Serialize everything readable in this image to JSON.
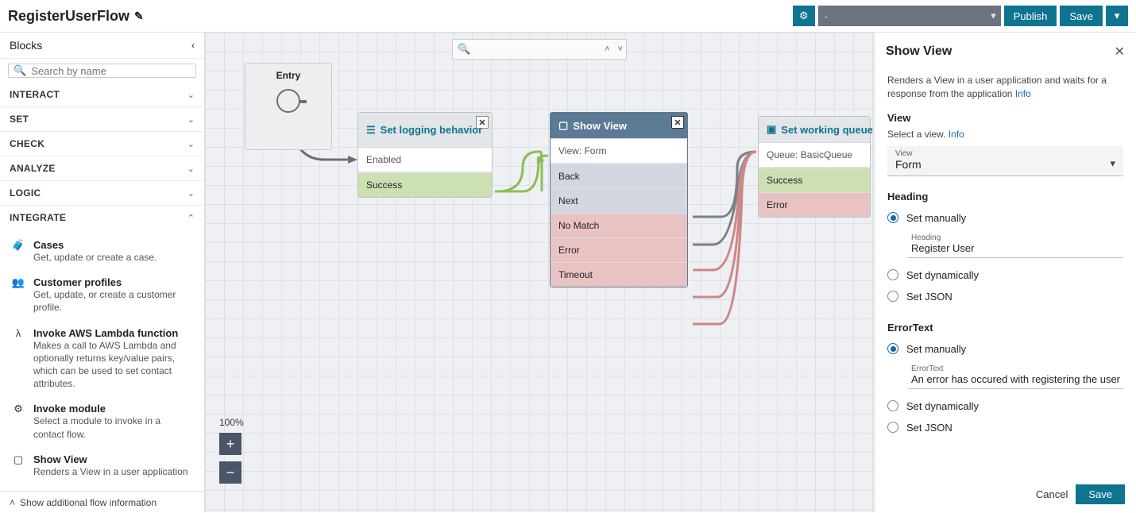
{
  "header": {
    "title": "RegisterUserFlow",
    "env_select": "-",
    "publish": "Publish",
    "save": "Save"
  },
  "sidebar": {
    "title": "Blocks",
    "search_placeholder": "Search by name",
    "categories": {
      "interact": "INTERACT",
      "set": "SET",
      "check": "CHECK",
      "analyze": "ANALYZE",
      "logic": "LOGIC",
      "integrate": "INTEGRATE"
    },
    "integrate_items": [
      {
        "name": "Cases",
        "desc": "Get, update or create a case."
      },
      {
        "name": "Customer profiles",
        "desc": "Get, update, or create a customer profile."
      },
      {
        "name": "Invoke AWS Lambda function",
        "desc": "Makes a call to AWS Lambda and optionally returns key/value pairs, which can be used to set contact attributes."
      },
      {
        "name": "Invoke module",
        "desc": "Select a module to invoke in a contact flow."
      },
      {
        "name": "Show View",
        "desc": "Renders a View in a user application"
      }
    ],
    "footer": "Show additional flow information"
  },
  "canvas": {
    "zoom": "100%",
    "entry": "Entry",
    "log": {
      "title": "Set logging behavior",
      "sub": "Enabled",
      "out": "Success"
    },
    "show": {
      "title": "Show View",
      "sub": "View: Form",
      "outs": [
        "Back",
        "Next",
        "No Match",
        "Error",
        "Timeout"
      ]
    },
    "queue": {
      "title": "Set working queue",
      "sub": "Queue: BasicQueue",
      "outs": [
        "Success",
        "Error"
      ]
    }
  },
  "panel": {
    "title": "Show View",
    "description": "Renders a View in a user application and waits for a response from the application ",
    "info": "Info",
    "view_heading": "View",
    "view_help": "Select a view. ",
    "view_field_label": "View",
    "view_field_value": "Form",
    "heading_section": "Heading",
    "radio_manual": "Set manually",
    "radio_dynamic": "Set dynamically",
    "radio_json": "Set JSON",
    "heading_field_label": "Heading",
    "heading_field_value": "Register User",
    "error_section": "ErrorText",
    "error_field_label": "ErrorText",
    "error_field_value": "An error has occured with registering the user",
    "cancel": "Cancel",
    "save": "Save"
  }
}
